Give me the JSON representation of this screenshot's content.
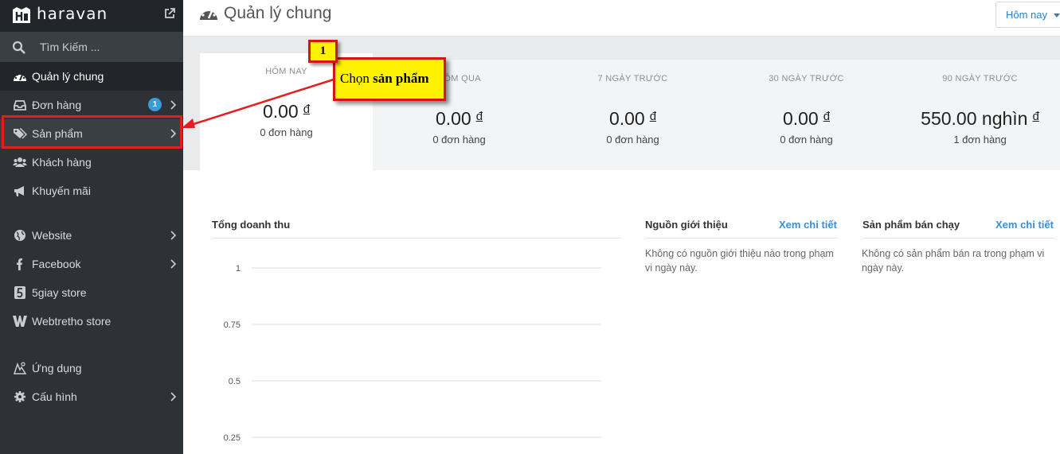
{
  "brand": {
    "name": "haravan"
  },
  "sidebar": {
    "search_placeholder": "Tìm Kiếm ...",
    "items": [
      {
        "label": "Quản lý chung",
        "icon": "dashboard-icon"
      },
      {
        "label": "Đơn hàng",
        "icon": "inbox-icon",
        "badge": "1"
      },
      {
        "label": "Sản phẩm",
        "icon": "tags-icon"
      },
      {
        "label": "Khách hàng",
        "icon": "users-icon"
      },
      {
        "label": "Khuyến mãi",
        "icon": "bullhorn-icon"
      },
      {
        "label": "Website",
        "icon": "globe-icon"
      },
      {
        "label": "Facebook",
        "icon": "facebook-icon"
      },
      {
        "label": "5giay store",
        "icon": "5giay-icon"
      },
      {
        "label": "Webtretho store",
        "icon": "webtretho-icon"
      },
      {
        "label": "Ứng dụng",
        "icon": "apps-icon"
      },
      {
        "label": "Cấu hình",
        "icon": "gear-icon"
      }
    ]
  },
  "header": {
    "title": "Quản lý chung",
    "date_filter": "Hôm nay"
  },
  "stats": [
    {
      "label": "HÔM NAY",
      "value": "0.00",
      "currency": "đ",
      "orders": "0 đơn hàng"
    },
    {
      "label": "HÔM QUA",
      "value": "0.00",
      "currency": "đ",
      "orders": "0 đơn hàng"
    },
    {
      "label": "7 NGÀY TRƯỚC",
      "value": "0.00",
      "currency": "đ",
      "orders": "0 đơn hàng"
    },
    {
      "label": "30 NGÀY TRƯỚC",
      "value": "0.00",
      "currency": "đ",
      "orders": "0 đơn hàng"
    },
    {
      "label": "90 NGÀY TRƯỚC",
      "value": "550.00 nghìn",
      "currency": "đ",
      "orders": "1 đơn hàng"
    }
  ],
  "revenue": {
    "title": "Tổng doanh thu",
    "y_ticks": [
      "1",
      "0.75",
      "0.5",
      "0.25"
    ]
  },
  "referrals": {
    "title": "Nguồn giới thiệu",
    "link": "Xem chi tiết",
    "empty": "Không có nguồn giới thiệu nào trong phạm vi ngày này."
  },
  "best_sellers": {
    "title": "Sản phẩm bán chạy",
    "link": "Xem chi tiết",
    "empty": "Không có sản phẩm bán ra trong phạm vi ngày này."
  },
  "annotation": {
    "step": "1",
    "text_prefix": "Chọn ",
    "text_bold": "sản phẩm"
  },
  "colors": {
    "sidebar_bg": "#2e3237",
    "accent": "#3b8fd6",
    "callout_fill": "#fff200",
    "callout_border": "#d11616"
  }
}
